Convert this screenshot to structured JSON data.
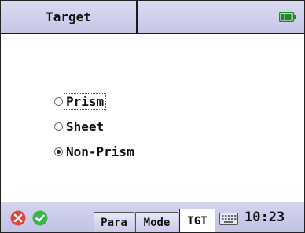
{
  "header": {
    "title": "Target",
    "battery_icon": "battery-full-icon",
    "battery_color": "#1e8a1e"
  },
  "options": [
    {
      "label": "Prism",
      "checked": false,
      "focused": true
    },
    {
      "label": "Sheet",
      "checked": false,
      "focused": false
    },
    {
      "label": "Non-Prism",
      "checked": true,
      "focused": false
    }
  ],
  "bottombar": {
    "cancel_icon": "close-icon",
    "cancel_color": "#e0443c",
    "ok_icon": "check-icon",
    "ok_color": "#3ab54a",
    "tabs": [
      {
        "label": "Para",
        "active": false
      },
      {
        "label": "Mode",
        "active": false
      },
      {
        "label": "TGT",
        "active": true
      }
    ],
    "keyboard_icon": "keyboard-icon",
    "time": "10:23"
  }
}
